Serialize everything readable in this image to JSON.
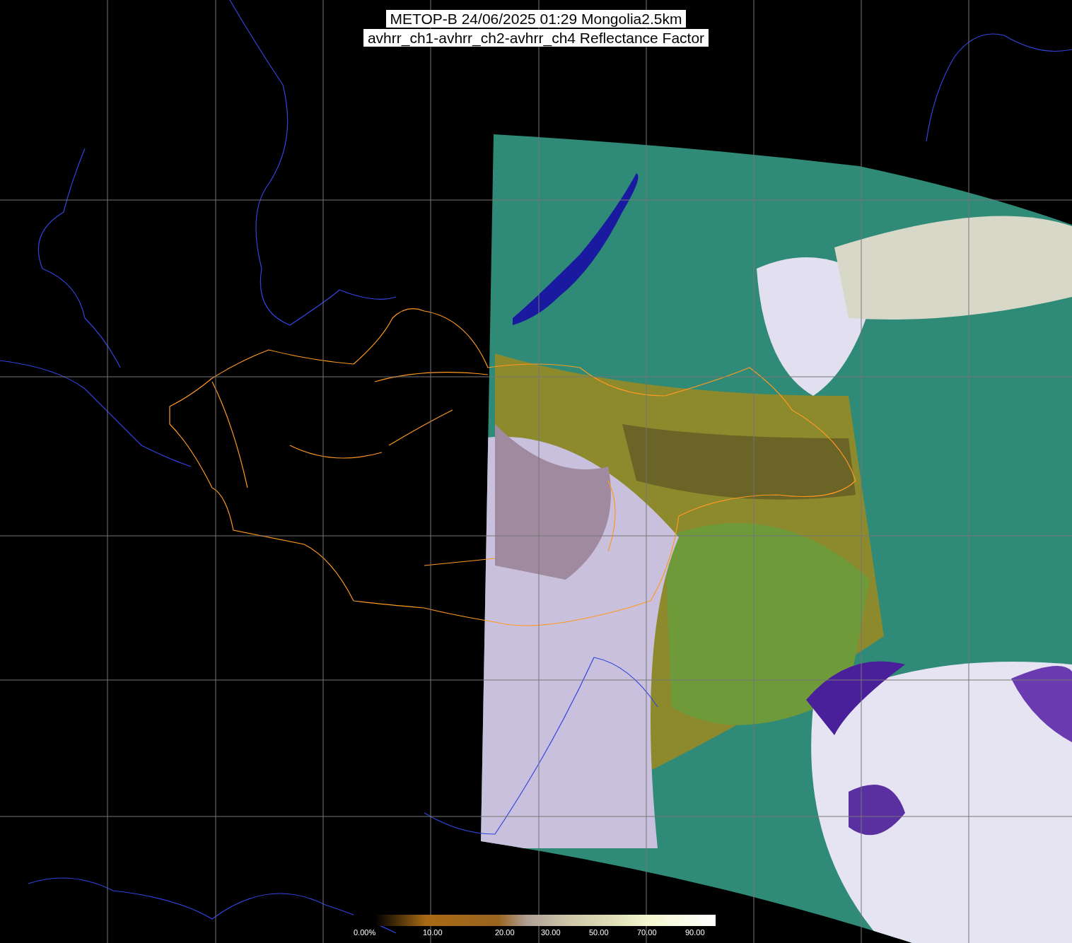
{
  "title": {
    "lines": [
      "METOP-B 24/06/2025 01:29 Mongolia2.5km",
      "avhrr_ch1-avhrr_ch2-avhrr_ch4 Reflectance Factor"
    ]
  },
  "legend": {
    "labels": [
      "0.00%",
      "10.00",
      "20.00",
      "30.00",
      "50.00",
      "70.00",
      "90.00"
    ]
  }
}
